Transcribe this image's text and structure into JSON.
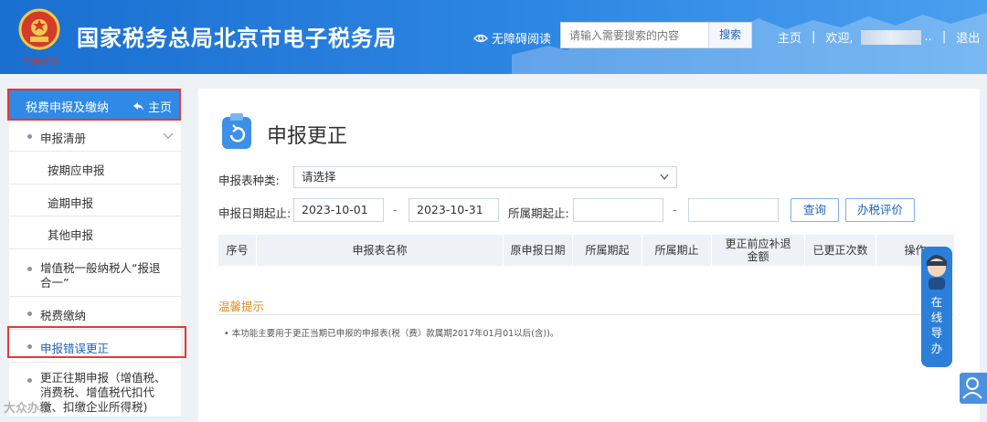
{
  "header": {
    "title": "国家税务总局北京市电子税务局",
    "emblem_script": "中国税务",
    "accessible": "无障碍阅读",
    "search_placeholder": "请输入需要搜索的内容",
    "search_button": "搜索",
    "home_link": "主页",
    "welcome": "欢迎,",
    "welcome_suffix": "..",
    "logout": "退出"
  },
  "sidebar": {
    "head_title": "税费申报及缴纳",
    "head_home": "主页",
    "items": [
      {
        "label": "申报清册"
      },
      {
        "label": "按期应申报"
      },
      {
        "label": "逾期申报"
      },
      {
        "label": "其他申报"
      },
      {
        "label_line1": "增值税一般纳税人“报退",
        "label_line2": "合一”"
      },
      {
        "label": "税费缴纳"
      },
      {
        "label": "申报错误更正"
      },
      {
        "label_line1": "更正往期申报（增值税、",
        "label_line2": "消费税、增值税代扣代",
        "label_line3": "缴、扣缴企业所得税)"
      }
    ]
  },
  "main": {
    "title": "申报更正",
    "form": {
      "type_label": "申报表种类:",
      "type_value": "请选择",
      "date_label": "申报日期起止:",
      "date_from": "2023-10-01",
      "date_to": "2023-10-31",
      "dash": "-",
      "period_label": "所属期起止:",
      "period_from": "",
      "period_to": "",
      "query_button": "查询",
      "eval_button": "办税评价"
    },
    "table_headers": [
      "序号",
      "申报表名称",
      "原申报日期",
      "所属期起",
      "所属期止",
      "更正前应补退金额",
      "已更正次数",
      "操作"
    ],
    "tips_title": "温馨提示",
    "tip": "• 本功能主要用于更正当期已申报的申报表(税（费）款属期2017年01月01以后(含))。"
  },
  "guide": {
    "text": "在线导办"
  },
  "watermark": "大众办税",
  "colors": {
    "header_blue": "#1a6fd0",
    "accent_blue": "#2f8ae6",
    "highlight_red": "#e53935",
    "tip_orange": "#e88b1a"
  }
}
